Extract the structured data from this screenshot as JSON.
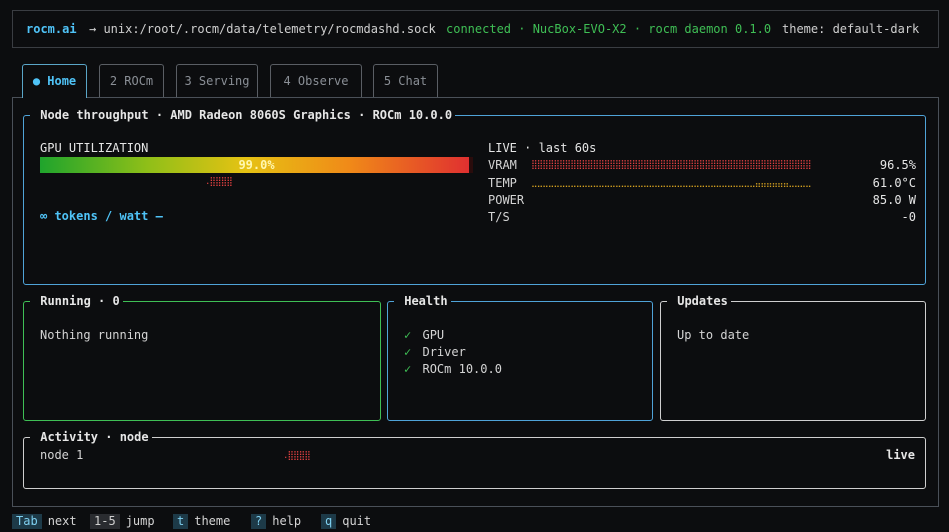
{
  "header": {
    "brand": "rocm.ai",
    "socket": "→ unix:/root/.rocm/data/telemetry/rocmdashd.sock",
    "status": "connected · NucBox-EVO-X2 · rocm daemon 0.1.0",
    "theme": "theme: default-dark"
  },
  "tabs": [
    {
      "label": "● Home",
      "active": true
    },
    {
      "label": "2 ROCm",
      "active": false
    },
    {
      "label": "3 Serving",
      "active": false
    },
    {
      "label": "4 Observe",
      "active": false
    },
    {
      "label": "5 Chat",
      "active": false
    }
  ],
  "throughput": {
    "title": "Node throughput · AMD Radeon 8060S Graphics · ROCm 10.0.0",
    "gpu_label": "GPU UTILIZATION",
    "gpu_value": "99.0%",
    "gpu_fraction": 0.99,
    "gpu_spark": ".⣿⣿⣿⣿",
    "tokens_watt": "∞ tokens / watt –",
    "live_label": "LIVE · last 60s",
    "metrics": [
      {
        "label": "VRAM",
        "spark": "⣿⣿⣿⣿⣿⣿⣿⣿⣿⣿⣿⣿⣿⣿⣿⣿⣿⣿⣿⣿⣿⣿⣿⣿⣿⣿⣿⣿⣿⣿⣿⣿⣿⣿⣿⣿⣿⣿⣿⣿⣿⣿⣿⣿⣿⣿⣿⣿⣿⣿",
        "value": "96.5%",
        "color": "#e04040"
      },
      {
        "label": "TEMP",
        "spark": "⣀⣀⣀⣀⣀⣀⣀⣀⣀⣀⣀⣀⣀⣀⣀⣀⣀⣀⣀⣀⣀⣀⣀⣀⣀⣀⣀⣀⣀⣀⣀⣀⣀⣀⣀⣀⣀⣀⣀⣀⣤⣤⣤⣤⣤⣤⣀⣀⣀⣀",
        "value": "61.0°C",
        "color": "#d4a020"
      },
      {
        "label": "POWER",
        "spark": "",
        "value": "85.0 W",
        "color": "#e6e6e6"
      },
      {
        "label": "T/S",
        "spark": "",
        "value": "-0",
        "color": "#4fc3f7"
      }
    ]
  },
  "running": {
    "title": "Running · 0",
    "body": "Nothing running"
  },
  "health": {
    "title": "Health",
    "items": [
      {
        "check": "✓",
        "label": "GPU"
      },
      {
        "check": "✓",
        "label": "Driver"
      },
      {
        "check": "✓",
        "label": "ROCm 10.0.0"
      }
    ]
  },
  "updates": {
    "title": "Updates",
    "body": "Up to date"
  },
  "activity": {
    "title": "Activity · node",
    "node": "node 1",
    "spark": ".⣿⣿⣿⣿",
    "live": "live"
  },
  "footer": [
    {
      "key": "Tab",
      "action": "next"
    },
    {
      "key": "1-5",
      "action": "jump"
    },
    {
      "key": "t",
      "action": "theme"
    },
    {
      "key": "?",
      "action": "help"
    },
    {
      "key": "q",
      "action": "quit"
    }
  ],
  "colors": {
    "accent": "#4fc3f7",
    "ok": "#3fbf55",
    "panel_running": "#3fbf55",
    "panel_health": "#4fa3d8",
    "panel_updates": "#cfcfcf"
  }
}
